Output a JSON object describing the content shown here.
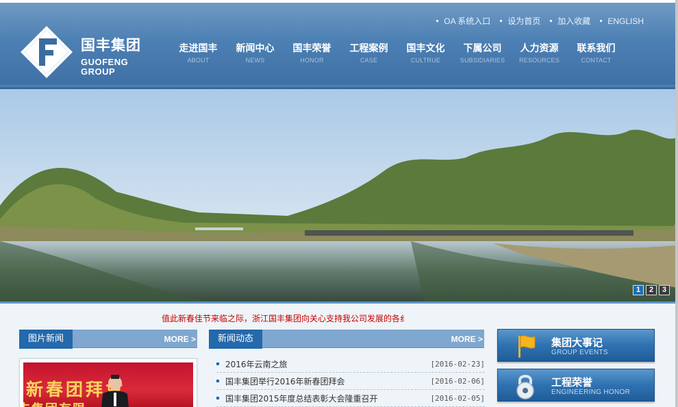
{
  "brand": {
    "name_cn": "国丰集团",
    "name_en_line1": "GUOFENG",
    "name_en_line2": "GROUP",
    "logo_icon": "letter-f-diamond-icon"
  },
  "top_links": [
    {
      "label": "OA 系统入口"
    },
    {
      "label": "设为首页"
    },
    {
      "label": "加入收藏"
    },
    {
      "label": "ENGLISH"
    }
  ],
  "nav": [
    {
      "cn": "走进国丰",
      "en": "ABOUT"
    },
    {
      "cn": "新闻中心",
      "en": "NEWS"
    },
    {
      "cn": "国丰荣誉",
      "en": "HONOR"
    },
    {
      "cn": "工程案例",
      "en": "CASE"
    },
    {
      "cn": "国丰文化",
      "en": "CULTRUE"
    },
    {
      "cn": "下属公司",
      "en": "SUBSIDIARIES"
    },
    {
      "cn": "人力资源",
      "en": "RESOURCES"
    },
    {
      "cn": "联系我们",
      "en": "CONTACT"
    }
  ],
  "banner": {
    "slides": [
      "1",
      "2",
      "3"
    ],
    "active_slide": 1
  },
  "marquee_text": "值此新春佳节来临之际，浙江国丰集团向关心支持我公司发展的各纟",
  "photo_news": {
    "title": "图片新闻",
    "more": "MORE >",
    "photo_caption_line1": "新春团拜會",
    "photo_caption_line2": "丰集团有限"
  },
  "news": {
    "title": "新闻动态",
    "more": "MORE >",
    "items": [
      {
        "title": "2016年云南之旅",
        "date": "[2016-02-23]"
      },
      {
        "title": "国丰集团举行2016年新春团拜会",
        "date": "[2016-02-06]"
      },
      {
        "title": "国丰集团2015年度总结表彰大会隆重召开",
        "date": "[2016-02-05]"
      }
    ]
  },
  "side_buttons": [
    {
      "cn": "集团大事记",
      "en": "GROUP EVENTS",
      "icon": "flag-icon"
    },
    {
      "cn": "工程荣誉",
      "en": "ENGINEERING HONOR",
      "icon": "padlock-icon"
    }
  ],
  "colors": {
    "header_blue": "#4c7fb3",
    "panel_title_blue": "#2369ab",
    "marquee_red": "#c80000"
  }
}
